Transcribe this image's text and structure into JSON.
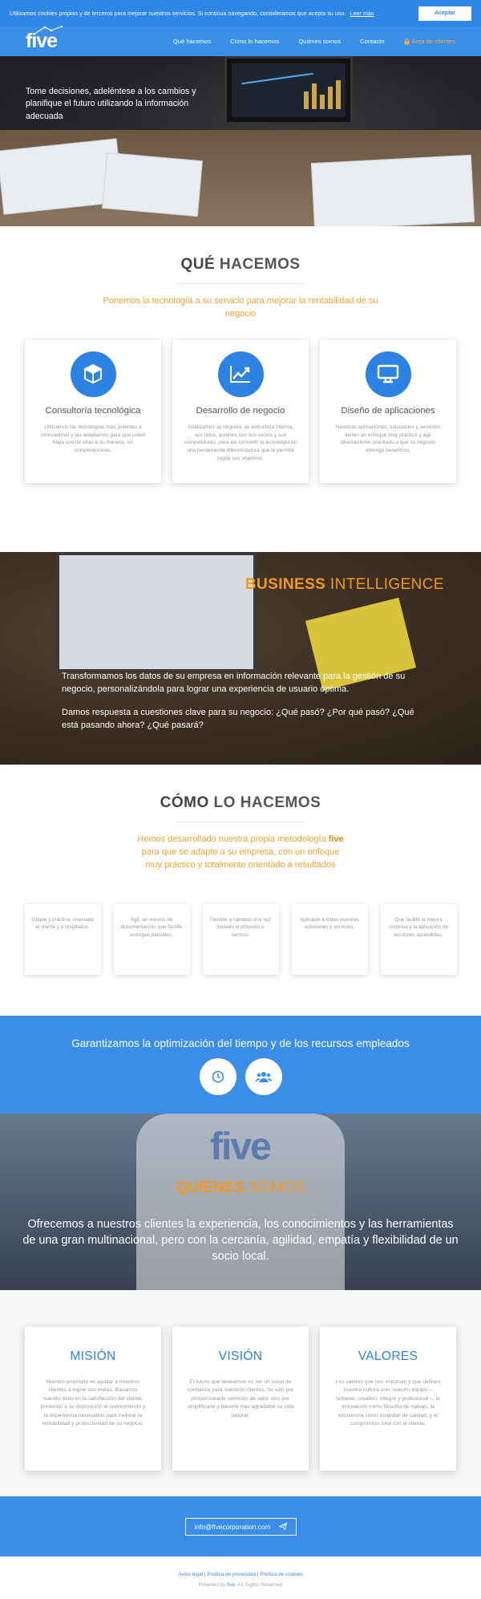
{
  "cookie": {
    "text": "Utilizamos cookies propias y de terceros para mejorar nuestros servicios. Si continua navegando, consideramos que acepta su uso.",
    "more": "Leer más",
    "accept": "Aceptar"
  },
  "nav": {
    "logo": "five",
    "items": [
      "Qué hacemos",
      "Cómo lo hacemos",
      "Quiénes somos",
      "Contacto"
    ],
    "cta": "Área de clientes"
  },
  "hero": {
    "text": "Tome decisiones, adeléntese a los cambios y planifique el futuro utilizando la información adecuada"
  },
  "que": {
    "title_bold": "QUÉ",
    "title_rest": " HACEMOS",
    "lead": "Ponemos la tecnología a su servicio para mejorar la rentabilidad de su negocio",
    "cards": [
      {
        "title": "Consultoría tecnológica",
        "text": "Utilizamos las tecnologías más potentes e innovadoras y las adaptamos para que usted haga uso de ellas a su manera, sin complicaciones."
      },
      {
        "title": "Desarrollo de negocio",
        "text": "Analizamos su negocio, su estructura interna, sus retos, quiénes son sus socios y sus competidores, para así convertir la tecnología en una herramienta diferenciadora que le permita lograr sus objetivos."
      },
      {
        "title": "Diseño de aplicaciones",
        "text": "Nuestras aplicaciones, soluciones y servicios tienen un enfoque muy práctico y ágil directamente orientado a que su negocio obtenga beneficios."
      }
    ]
  },
  "bi": {
    "title_bold": "BUSINESS",
    "title_rest": " INTELLIGENCE",
    "p1": "Transformamos los datos de su empresa en información relevante para la gestión de su negocio, personalizándola para lograr una experiencia de usuario óptima.",
    "p2": "Damos respuesta a cuestiones clave para su negocio: ¿Qué pasó? ¿Por qué pasó? ¿Qué está pasando ahora? ¿Qué pasará?"
  },
  "como": {
    "title_bold": "CÓMO",
    "title_rest": " LO HACEMOS",
    "lead_a": "Hemos desarrollado nuestra propia metodología ",
    "lead_brand": "five",
    "lead_b": " para que se adapte a su empresa, con un enfoque muy práctico y totalmente orientado a resultados",
    "steps": [
      "Simple y práctica, orientada al cliente y a resultados.",
      "Ágil, sin exceso de documentación, que facilite entregas parciales.",
      "Flexible a cambios una vez iniciado el proyecto o servicio.",
      "Aplicable a todas nuestras soluciones y servicios.",
      "Que facilite la mejora continua y la aplicación de lecciones aprendidas."
    ]
  },
  "opt": {
    "title": "Garantizamos la optimización del tiempo y de los recursos empleados"
  },
  "quienes": {
    "shirt_logo": "five",
    "title_bold": "QUIÉNES",
    "title_rest": " SOMOS",
    "text": "Ofrecemos a nuestros clientes la experiencia, los conocimientos y las herramientas de una gran multinacional, pero con la cercanía, agilidad, empatía y flexibilidad de un socio local."
  },
  "mvv": [
    {
      "title": "MISIÓN",
      "text": "Nuestro propósito es ayudar a nuestros clientes a lograr sus metas. Basamos nuestro éxito en la satisfacción del cliente, poniendo a su disposición el conocimiento y la experiencia necesarios para mejorar la rentabilidad y productividad de su negocio."
    },
    {
      "title": "VISIÓN",
      "text": "El futuro que deseamos es ser un socio de confianza para nuestros clientes, no sólo por proporcionarle servicios de valor sino por simplificarle y hacerle más agradable su vida laboral."
    },
    {
      "title": "VALORES",
      "text": "Los valores que nos impulsan y que definen nuestra cultura son: nuestro equipo –brillante, creativo, íntegro y profesional –, la innovación como filosofía de trabajo, la excelencia como estándar de calidad, y el compromiso total con el cliente."
    }
  ],
  "contact": {
    "email": "info@fivecorporation.com"
  },
  "footer": {
    "links": [
      "Aviso legal",
      "Política de privacidad",
      "Política de cookies"
    ],
    "sep": " | ",
    "powered_a": "Powered by ",
    "powered_brand": "five",
    "powered_b": ". All Rights Reserved"
  },
  "colors": {
    "primary": "#3a8ee8",
    "accent": "#f19a1e"
  }
}
